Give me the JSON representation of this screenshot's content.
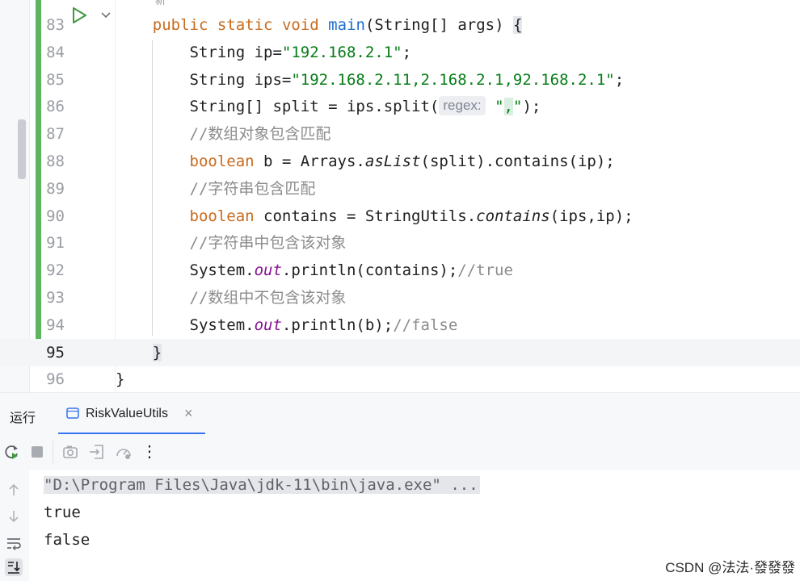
{
  "editor": {
    "top_fragment": "新",
    "lines": [
      {
        "num": "83",
        "tokens": [
          {
            "t": "    "
          },
          {
            "t": "public",
            "c": "kw2"
          },
          {
            "t": " "
          },
          {
            "t": "static",
            "c": "kw2"
          },
          {
            "t": " "
          },
          {
            "t": "void",
            "c": "kw2"
          },
          {
            "t": " "
          },
          {
            "t": "main",
            "c": "fn"
          },
          {
            "t": "(String[] args) "
          },
          {
            "t": "{",
            "c": "brace-hl"
          }
        ]
      },
      {
        "num": "84",
        "tokens": [
          {
            "t": "        String ip="
          },
          {
            "t": "\"192.168.2.1\"",
            "c": "str"
          },
          {
            "t": ";"
          }
        ]
      },
      {
        "num": "85",
        "tokens": [
          {
            "t": "        String ips="
          },
          {
            "t": "\"192.168.2.11,2.168.2.1,92.168.2.1\"",
            "c": "str"
          },
          {
            "t": ";"
          }
        ]
      },
      {
        "num": "86",
        "tokens": [
          {
            "t": "        String[] split = ips.split("
          },
          {
            "hint": "regex:"
          },
          {
            "t": " "
          },
          {
            "t": "\"",
            "c": "str"
          },
          {
            "t": ",",
            "c": "str comma-box"
          },
          {
            "t": "\"",
            "c": "str"
          },
          {
            "t": ");"
          }
        ]
      },
      {
        "num": "87",
        "tokens": [
          {
            "t": "        //数组对象包含匹配",
            "c": "cm"
          }
        ]
      },
      {
        "num": "88",
        "tokens": [
          {
            "t": "        "
          },
          {
            "t": "boolean",
            "c": "kw2"
          },
          {
            "t": " b = Arrays."
          },
          {
            "t": "asList",
            "c": "it"
          },
          {
            "t": "(split).contains(ip);"
          }
        ]
      },
      {
        "num": "89",
        "tokens": [
          {
            "t": "        //字符串包含匹配",
            "c": "cm"
          }
        ]
      },
      {
        "num": "90",
        "tokens": [
          {
            "t": "        "
          },
          {
            "t": "boolean",
            "c": "kw2"
          },
          {
            "t": " contains = StringUtils."
          },
          {
            "t": "contains",
            "c": "it"
          },
          {
            "t": "(ips,ip);"
          }
        ]
      },
      {
        "num": "91",
        "tokens": [
          {
            "t": "        //字符串中包含该对象",
            "c": "cm"
          }
        ]
      },
      {
        "num": "92",
        "tokens": [
          {
            "t": "        System."
          },
          {
            "t": "out",
            "c": "field"
          },
          {
            "t": ".println(contains);"
          },
          {
            "t": "//true",
            "c": "cm"
          }
        ]
      },
      {
        "num": "93",
        "tokens": [
          {
            "t": "        //数组中不包含该对象",
            "c": "cm"
          }
        ]
      },
      {
        "num": "94",
        "tokens": [
          {
            "t": "        System."
          },
          {
            "t": "out",
            "c": "field"
          },
          {
            "t": ".println(b);"
          },
          {
            "t": "//false",
            "c": "cm"
          }
        ]
      },
      {
        "num": "95",
        "tokens": [
          {
            "t": "    "
          },
          {
            "t": "}",
            "c": "brace-hl"
          }
        ],
        "current": true
      },
      {
        "num": "96",
        "tokens": [
          {
            "t": "}"
          }
        ]
      }
    ]
  },
  "run_panel": {
    "label": "运行",
    "tab_label": "RiskValueUtils",
    "tab_close": "×"
  },
  "toolbar": {
    "more": "⋮"
  },
  "console": {
    "command": "\"D:\\Program Files\\Java\\jdk-11\\bin\\java.exe\" ...",
    "output": [
      "true",
      "false"
    ]
  },
  "watermark": "CSDN @法法·發發發",
  "colors": {
    "accent": "#3574f0",
    "run_green": "#5fb55f",
    "keyword": "#c96b1e",
    "string": "#067d17",
    "comment": "#8c8c8c"
  }
}
